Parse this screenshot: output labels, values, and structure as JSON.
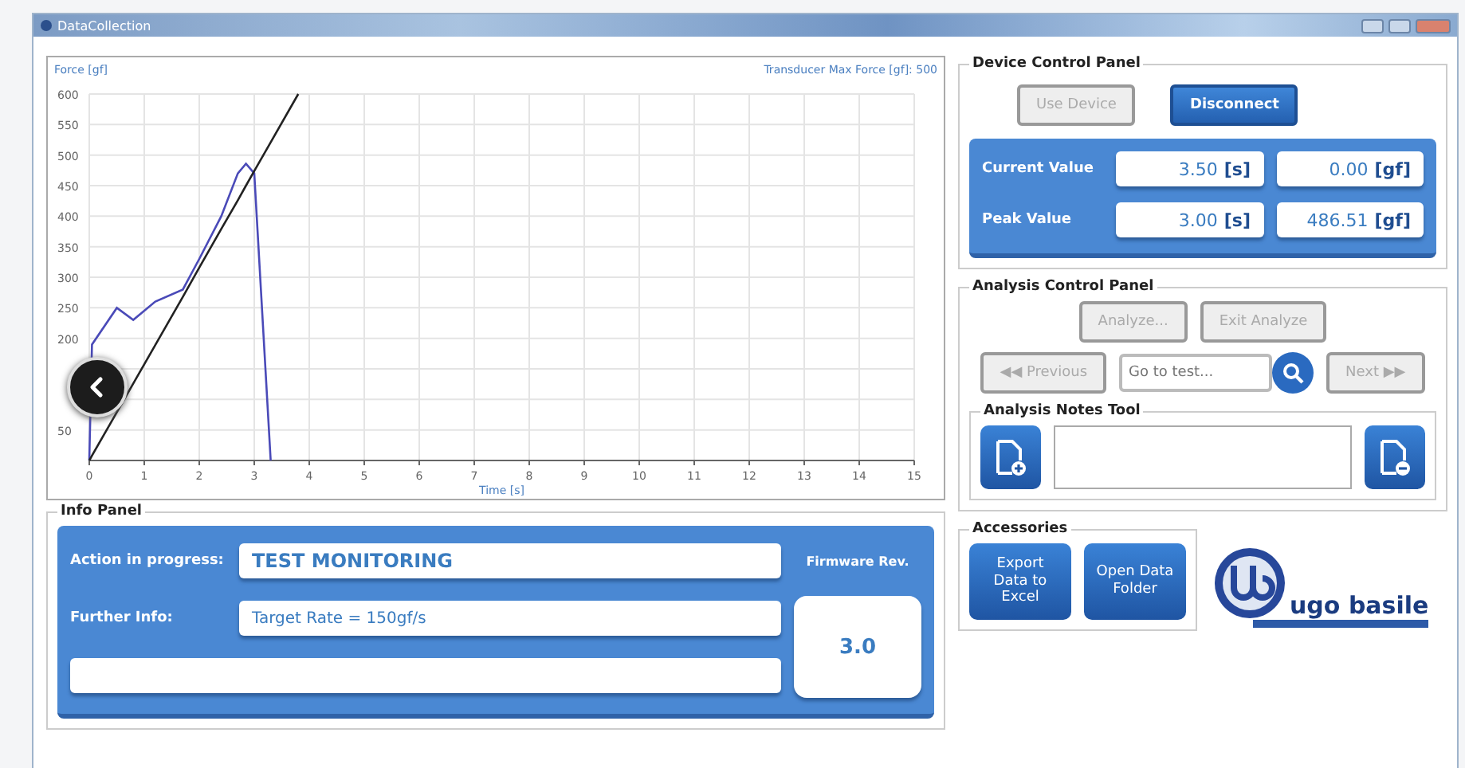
{
  "window": {
    "title": "DataCollection"
  },
  "chart": {
    "chart_data": {
      "type": "line",
      "ylabel": "Force [gf]",
      "xlabel": "Time [s]",
      "annotations": [
        "Transducer Max Force [gf]: 500"
      ],
      "x": [
        0,
        0.05,
        0.5,
        0.8,
        1.2,
        1.7,
        2.0,
        2.4,
        2.7,
        2.85,
        3.0,
        3.3,
        3.8
      ],
      "series": [
        {
          "color": "#4a4ab8",
          "values": [
            0,
            190,
            250,
            230,
            260,
            280,
            330,
            400,
            470,
            486,
            470,
            0,
            null
          ]
        },
        {
          "color": "#222222",
          "values": [
            0,
            8,
            79,
            126,
            189,
            268,
            316,
            379,
            426,
            450,
            474,
            521,
            600
          ]
        }
      ],
      "xlim": [
        0,
        15
      ],
      "ylim": [
        0,
        600
      ],
      "xticks": [
        0,
        1,
        2,
        3,
        4,
        5,
        6,
        7,
        8,
        9,
        10,
        11,
        12,
        13,
        14,
        15
      ],
      "yticks": [
        50,
        200,
        250,
        300,
        350,
        400,
        450,
        500,
        550,
        600
      ],
      "grid": true
    }
  },
  "device_panel": {
    "title": "Device Control Panel",
    "buttons": [
      {
        "label": "Use Device",
        "disabled": true
      },
      {
        "label": "Disconnect",
        "disabled": false
      }
    ],
    "rows": [
      {
        "label": "Current Value",
        "time": "3.50 **[s]**",
        "force": "0.00 **[gf]**"
      },
      {
        "label": "Peak Value",
        "time": "3.00 **[s]**",
        "force": "486.51 **[gf]**"
      }
    ]
  },
  "analysis_panel": {
    "title": "Analysis Control Panel",
    "buttons": [
      {
        "label": "Analyze...",
        "disabled": true
      },
      {
        "label": "Exit Analyze",
        "disabled": true
      }
    ],
    "previous": {
      "label": "◀◀ Previous",
      "disabled": true
    },
    "goto": {
      "placeholder": "Go to test..."
    },
    "next": {
      "label": "Next ▶▶",
      "disabled": true
    },
    "notes": {
      "title": "Analysis Notes Tool"
    }
  },
  "accessories": {
    "title": "Accessories",
    "buttons": [
      "Export Data to Excel",
      "Open Data Folder"
    ]
  },
  "logo": {
    "text": "ugo basile"
  },
  "info_panel": {
    "title": "Info Panel",
    "action": {
      "label": "Action in progress:",
      "value": "TEST MONITORING"
    },
    "further": {
      "label": "Further Info:",
      "value": "Target Rate = 150gf/s"
    },
    "firmware": {
      "label": "Firmware Rev.",
      "value": "3.0"
    }
  }
}
